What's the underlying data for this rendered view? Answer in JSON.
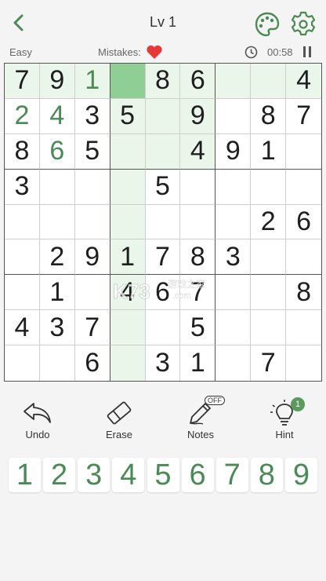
{
  "header": {
    "title": "Lv 1"
  },
  "status": {
    "difficulty": "Easy",
    "mistakes_label": "Mistakes:",
    "timer": "00:58"
  },
  "colors": {
    "accent": "#4a8a55",
    "selected": "#8fcf95",
    "highlight": "#e9f6e9",
    "heart": "#e53935"
  },
  "board": {
    "selected": [
      0,
      3
    ],
    "rows": [
      [
        "7",
        "9",
        "1",
        "",
        "8",
        "6",
        "",
        "",
        "4"
      ],
      [
        "2",
        "4",
        "3",
        "5",
        "",
        "9",
        "",
        "8",
        "7"
      ],
      [
        "8",
        "6",
        "5",
        "",
        "",
        "4",
        "9",
        "1",
        ""
      ],
      [
        "3",
        "",
        "",
        "",
        "5",
        "",
        "",
        "",
        ""
      ],
      [
        "",
        "",
        "",
        "",
        "",
        "",
        "",
        "2",
        "6"
      ],
      [
        "",
        "2",
        "9",
        "1",
        "7",
        "8",
        "3",
        "",
        ""
      ],
      [
        "",
        "1",
        "",
        "4",
        "6",
        "7",
        "",
        "",
        "8"
      ],
      [
        "4",
        "3",
        "7",
        "",
        "",
        "5",
        "",
        "",
        ""
      ],
      [
        "",
        "",
        "6",
        "",
        "3",
        "1",
        "",
        "7",
        ""
      ]
    ],
    "user_entered": [
      [
        0,
        2
      ],
      [
        1,
        0
      ],
      [
        1,
        1
      ],
      [
        2,
        1
      ]
    ]
  },
  "tools": {
    "undo": "Undo",
    "erase": "Erase",
    "notes": "Notes",
    "notes_state": "OFF",
    "hint": "Hint",
    "hint_count": "1"
  },
  "numpad": [
    "1",
    "2",
    "3",
    "4",
    "5",
    "6",
    "7",
    "8",
    "9"
  ],
  "watermark": {
    "logo": "K73",
    "text": "游戏之家",
    "domain": ".com"
  },
  "icons": {
    "back": "chevron-left-icon",
    "theme": "palette-icon",
    "settings": "gear-icon",
    "mistake": "heart-icon",
    "clock": "clock-icon",
    "pause": "pause-icon",
    "undo": "undo-arrow-icon",
    "erase": "eraser-icon",
    "notes": "pencil-icon",
    "hint": "lightbulb-icon"
  }
}
